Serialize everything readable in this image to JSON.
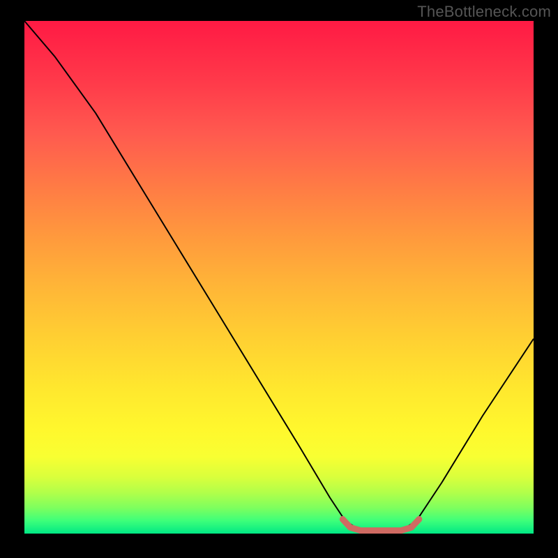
{
  "watermark": "TheBottleneck.com",
  "chart_data": {
    "type": "line",
    "title": "",
    "xlabel": "",
    "ylabel": "",
    "xlim": [
      0,
      100
    ],
    "ylim": [
      0,
      100
    ],
    "series": [
      {
        "name": "curve",
        "values": [
          {
            "x": 0,
            "y": 100
          },
          {
            "x": 6,
            "y": 93
          },
          {
            "x": 14,
            "y": 82
          },
          {
            "x": 22,
            "y": 69
          },
          {
            "x": 30,
            "y": 56
          },
          {
            "x": 38,
            "y": 43
          },
          {
            "x": 46,
            "y": 30
          },
          {
            "x": 54,
            "y": 17
          },
          {
            "x": 60,
            "y": 7
          },
          {
            "x": 63,
            "y": 2.5
          },
          {
            "x": 66,
            "y": 0.6
          },
          {
            "x": 74,
            "y": 0.6
          },
          {
            "x": 77,
            "y": 2.5
          },
          {
            "x": 82,
            "y": 10
          },
          {
            "x": 90,
            "y": 23
          },
          {
            "x": 100,
            "y": 38
          }
        ]
      }
    ],
    "annotations": [
      {
        "name": "valley-segment",
        "color": "#cf6a62",
        "points": [
          {
            "x": 62.5,
            "y": 2.8
          },
          {
            "x": 64,
            "y": 1.2
          },
          {
            "x": 66,
            "y": 0.6
          },
          {
            "x": 74,
            "y": 0.6
          },
          {
            "x": 76,
            "y": 1.2
          },
          {
            "x": 77.5,
            "y": 2.8
          }
        ]
      }
    ]
  }
}
